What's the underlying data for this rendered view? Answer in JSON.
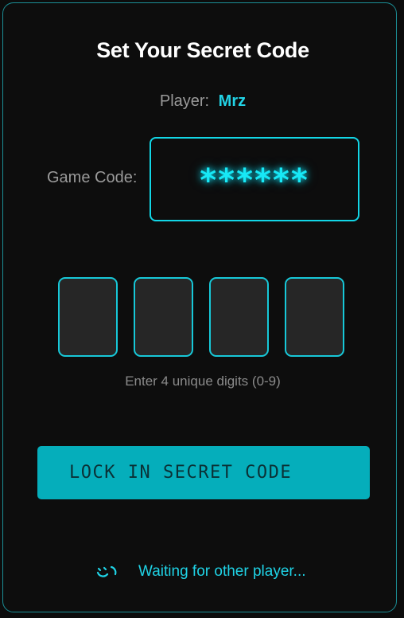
{
  "setup": {
    "title": "Set Your Secret Code",
    "player_label": "Player:",
    "player_name": "Mrz",
    "game_code_label": "Game Code:",
    "game_code_masked": "******",
    "digit_inputs": [
      {
        "value": ""
      },
      {
        "value": ""
      },
      {
        "value": ""
      },
      {
        "value": ""
      }
    ],
    "hint": "Enter 4 unique digits (0-9)",
    "lock_button_label": "LOCK IN SECRET CODE",
    "status_text": "Waiting for other player..."
  },
  "colors": {
    "accent": "#12d6e6",
    "button_bg": "#05aebb",
    "background": "#0d0d0d",
    "digit_box_bg": "#262626"
  },
  "icons": {
    "status": "loading-spinner-icon"
  }
}
